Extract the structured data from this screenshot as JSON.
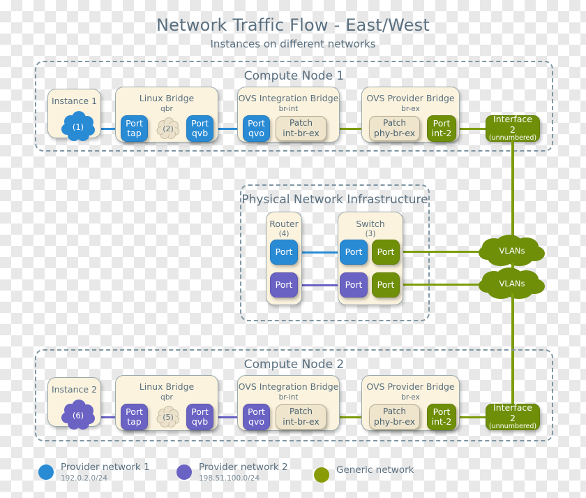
{
  "header": {
    "title": "Network Traffic Flow - East/West",
    "subtitle": "Instances on different networks"
  },
  "colors": {
    "provider1": "#2a8bd5",
    "provider2": "#6a63c4",
    "generic": "#6f8f09",
    "box_fill": "#fbf3de",
    "text": "#5a7080"
  },
  "compute_node_1": {
    "title": "Compute Node 1",
    "instance": {
      "title": "Instance 1",
      "cloud_label": "(1)"
    },
    "linux_bridge": {
      "title": "Linux Bridge",
      "subtitle": "qbr",
      "port_tap": {
        "l1": "Port",
        "l2": "tap"
      },
      "cloud_label": "(2)",
      "port_qvb": {
        "l1": "Port",
        "l2": "qvb"
      }
    },
    "ovs_integration_bridge": {
      "title": "OVS Integration Bridge",
      "subtitle": "br-int",
      "port_qvo": {
        "l1": "Port",
        "l2": "qvo"
      },
      "patch": {
        "l1": "Patch",
        "l2": "int-br-ex"
      }
    },
    "ovs_provider_bridge": {
      "title": "OVS Provider Bridge",
      "subtitle": "br-ex",
      "patch": {
        "l1": "Patch",
        "l2": "phy-br-ex"
      },
      "port_int2": {
        "l1": "Port",
        "l2": "int-2"
      }
    },
    "interface": {
      "l1": "Interface 2",
      "l2": "(unnumbered)"
    }
  },
  "compute_node_2": {
    "title": "Compute Node 2",
    "instance": {
      "title": "Instance 2",
      "cloud_label": "(6)"
    },
    "linux_bridge": {
      "title": "Linux Bridge",
      "subtitle": "qbr",
      "port_tap": {
        "l1": "Port",
        "l2": "tap"
      },
      "cloud_label": "(5)",
      "port_qvb": {
        "l1": "Port",
        "l2": "qvb"
      }
    },
    "ovs_integration_bridge": {
      "title": "OVS Integration Bridge",
      "subtitle": "br-int",
      "port_qvo": {
        "l1": "Port",
        "l2": "qvo"
      },
      "patch": {
        "l1": "Patch",
        "l2": "int-br-ex"
      }
    },
    "ovs_provider_bridge": {
      "title": "OVS Provider Bridge",
      "subtitle": "br-ex",
      "patch": {
        "l1": "Patch",
        "l2": "phy-br-ex"
      },
      "port_int2": {
        "l1": "Port",
        "l2": "int-2"
      }
    },
    "interface": {
      "l1": "Interface 2",
      "l2": "(unnumbered)"
    }
  },
  "physical_network": {
    "title": "Physical Network Infrastructure",
    "router": {
      "title": "Router",
      "subtitle": "(4)",
      "port_top": "Port",
      "port_bottom": "Port"
    },
    "switch": {
      "title": "Switch",
      "subtitle": "(3)",
      "port_top_left": "Port",
      "port_top_right": "Port",
      "port_bottom_left": "Port",
      "port_bottom_right": "Port"
    }
  },
  "vlans": {
    "top_label": "VLANs",
    "bottom_label": "VLANs"
  },
  "legend": {
    "items": [
      {
        "name": "Provider network 1",
        "cidr": "192.0.2.0/24",
        "color": "#2a8bd5"
      },
      {
        "name": "Provider network 2",
        "cidr": "198.51.100.0/24",
        "color": "#6a63c4"
      },
      {
        "name": "Generic network",
        "cidr": "",
        "color": "#8a9b08"
      }
    ]
  }
}
